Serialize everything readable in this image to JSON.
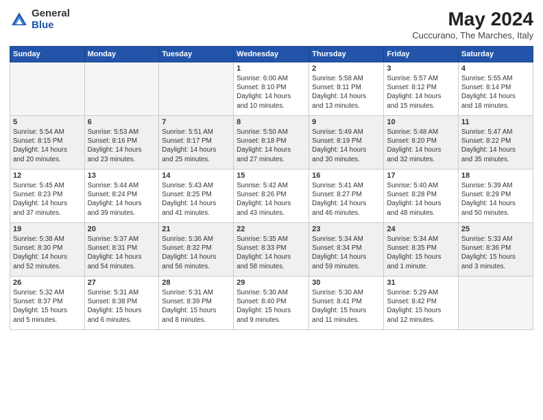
{
  "logo": {
    "general": "General",
    "blue": "Blue"
  },
  "title": "May 2024",
  "subtitle": "Cuccurano, The Marches, Italy",
  "days_header": [
    "Sunday",
    "Monday",
    "Tuesday",
    "Wednesday",
    "Thursday",
    "Friday",
    "Saturday"
  ],
  "weeks": [
    {
      "shaded": false,
      "days": [
        {
          "num": "",
          "info": ""
        },
        {
          "num": "",
          "info": ""
        },
        {
          "num": "",
          "info": ""
        },
        {
          "num": "1",
          "info": "Sunrise: 6:00 AM\nSunset: 8:10 PM\nDaylight: 14 hours\nand 10 minutes."
        },
        {
          "num": "2",
          "info": "Sunrise: 5:58 AM\nSunset: 8:11 PM\nDaylight: 14 hours\nand 13 minutes."
        },
        {
          "num": "3",
          "info": "Sunrise: 5:57 AM\nSunset: 8:12 PM\nDaylight: 14 hours\nand 15 minutes."
        },
        {
          "num": "4",
          "info": "Sunrise: 5:55 AM\nSunset: 8:14 PM\nDaylight: 14 hours\nand 18 minutes."
        }
      ]
    },
    {
      "shaded": true,
      "days": [
        {
          "num": "5",
          "info": "Sunrise: 5:54 AM\nSunset: 8:15 PM\nDaylight: 14 hours\nand 20 minutes."
        },
        {
          "num": "6",
          "info": "Sunrise: 5:53 AM\nSunset: 8:16 PM\nDaylight: 14 hours\nand 23 minutes."
        },
        {
          "num": "7",
          "info": "Sunrise: 5:51 AM\nSunset: 8:17 PM\nDaylight: 14 hours\nand 25 minutes."
        },
        {
          "num": "8",
          "info": "Sunrise: 5:50 AM\nSunset: 8:18 PM\nDaylight: 14 hours\nand 27 minutes."
        },
        {
          "num": "9",
          "info": "Sunrise: 5:49 AM\nSunset: 8:19 PM\nDaylight: 14 hours\nand 30 minutes."
        },
        {
          "num": "10",
          "info": "Sunrise: 5:48 AM\nSunset: 8:20 PM\nDaylight: 14 hours\nand 32 minutes."
        },
        {
          "num": "11",
          "info": "Sunrise: 5:47 AM\nSunset: 8:22 PM\nDaylight: 14 hours\nand 35 minutes."
        }
      ]
    },
    {
      "shaded": false,
      "days": [
        {
          "num": "12",
          "info": "Sunrise: 5:45 AM\nSunset: 8:23 PM\nDaylight: 14 hours\nand 37 minutes."
        },
        {
          "num": "13",
          "info": "Sunrise: 5:44 AM\nSunset: 8:24 PM\nDaylight: 14 hours\nand 39 minutes."
        },
        {
          "num": "14",
          "info": "Sunrise: 5:43 AM\nSunset: 8:25 PM\nDaylight: 14 hours\nand 41 minutes."
        },
        {
          "num": "15",
          "info": "Sunrise: 5:42 AM\nSunset: 8:26 PM\nDaylight: 14 hours\nand 43 minutes."
        },
        {
          "num": "16",
          "info": "Sunrise: 5:41 AM\nSunset: 8:27 PM\nDaylight: 14 hours\nand 46 minutes."
        },
        {
          "num": "17",
          "info": "Sunrise: 5:40 AM\nSunset: 8:28 PM\nDaylight: 14 hours\nand 48 minutes."
        },
        {
          "num": "18",
          "info": "Sunrise: 5:39 AM\nSunset: 8:29 PM\nDaylight: 14 hours\nand 50 minutes."
        }
      ]
    },
    {
      "shaded": true,
      "days": [
        {
          "num": "19",
          "info": "Sunrise: 5:38 AM\nSunset: 8:30 PM\nDaylight: 14 hours\nand 52 minutes."
        },
        {
          "num": "20",
          "info": "Sunrise: 5:37 AM\nSunset: 8:31 PM\nDaylight: 14 hours\nand 54 minutes."
        },
        {
          "num": "21",
          "info": "Sunrise: 5:36 AM\nSunset: 8:32 PM\nDaylight: 14 hours\nand 56 minutes."
        },
        {
          "num": "22",
          "info": "Sunrise: 5:35 AM\nSunset: 8:33 PM\nDaylight: 14 hours\nand 58 minutes."
        },
        {
          "num": "23",
          "info": "Sunrise: 5:34 AM\nSunset: 8:34 PM\nDaylight: 14 hours\nand 59 minutes."
        },
        {
          "num": "24",
          "info": "Sunrise: 5:34 AM\nSunset: 8:35 PM\nDaylight: 15 hours\nand 1 minute."
        },
        {
          "num": "25",
          "info": "Sunrise: 5:33 AM\nSunset: 8:36 PM\nDaylight: 15 hours\nand 3 minutes."
        }
      ]
    },
    {
      "shaded": false,
      "days": [
        {
          "num": "26",
          "info": "Sunrise: 5:32 AM\nSunset: 8:37 PM\nDaylight: 15 hours\nand 5 minutes."
        },
        {
          "num": "27",
          "info": "Sunrise: 5:31 AM\nSunset: 8:38 PM\nDaylight: 15 hours\nand 6 minutes."
        },
        {
          "num": "28",
          "info": "Sunrise: 5:31 AM\nSunset: 8:39 PM\nDaylight: 15 hours\nand 8 minutes."
        },
        {
          "num": "29",
          "info": "Sunrise: 5:30 AM\nSunset: 8:40 PM\nDaylight: 15 hours\nand 9 minutes."
        },
        {
          "num": "30",
          "info": "Sunrise: 5:30 AM\nSunset: 8:41 PM\nDaylight: 15 hours\nand 11 minutes."
        },
        {
          "num": "31",
          "info": "Sunrise: 5:29 AM\nSunset: 8:42 PM\nDaylight: 15 hours\nand 12 minutes."
        },
        {
          "num": "",
          "info": ""
        }
      ]
    }
  ]
}
